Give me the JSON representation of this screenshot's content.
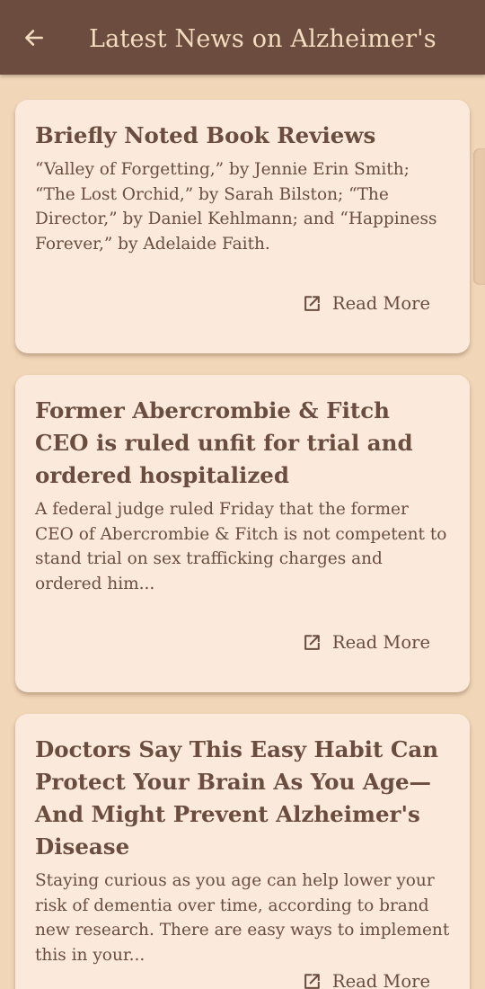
{
  "header": {
    "title": "Latest News on Alzheimer's",
    "back_icon": "arrow-left-icon"
  },
  "articles": [
    {
      "title": "Briefly Noted Book Reviews",
      "summary": "“Valley of Forgetting,” by Jennie Erin Smith; “The Lost Orchid,” by Sarah Bilston; “The Director,” by Daniel Kehlmann; and “Happiness Forever,” by Adelaide Faith.",
      "link_label": "Read More"
    },
    {
      "title": "Former Abercrombie & Fitch CEO is ruled unfit for trial and ordered hospitalized",
      "summary": "A federal judge ruled Friday that the former CEO of Abercrombie & Fitch is not competent to stand trial on sex trafficking charges and ordered him...",
      "link_label": "Read More"
    },
    {
      "title": "Doctors Say This Easy Habit Can Protect Your Brain As You Age—And Might Prevent Alzheimer's Disease",
      "summary": "Staying curious as you age can help lower your risk of dementia over time, according to brand new research. There are easy ways to implement this in your...",
      "link_label": "Read More"
    }
  ],
  "colors": {
    "header_bg": "#6b4c3e",
    "page_bg": "#f1d6b8",
    "card_bg": "#fbeadb",
    "text": "#6a4d3f",
    "header_text": "#f3dcc0"
  }
}
